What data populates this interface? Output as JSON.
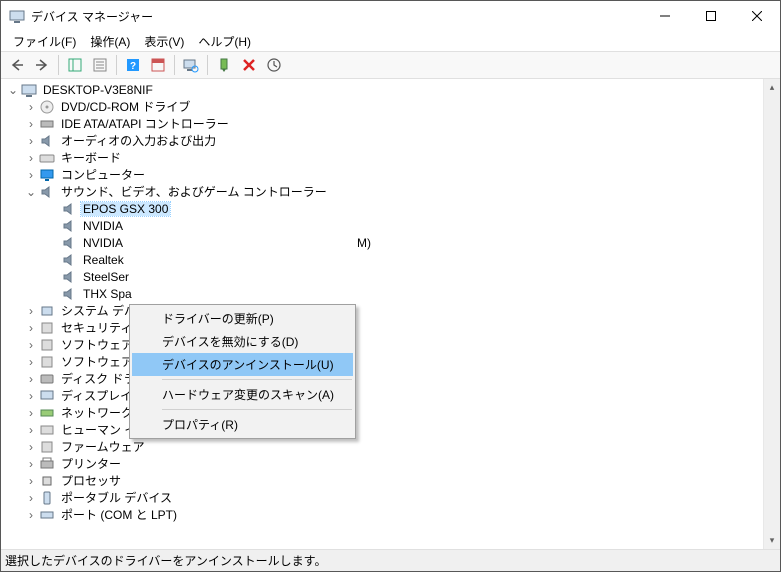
{
  "title": "デバイス マネージャー",
  "menubar": [
    "ファイル(F)",
    "操作(A)",
    "表示(V)",
    "ヘルプ(H)"
  ],
  "root": "DESKTOP-V3E8NIF",
  "categories": {
    "dvd": "DVD/CD-ROM ドライブ",
    "ide": "IDE ATA/ATAPI コントローラー",
    "audio": "オーディオの入力および出力",
    "keyboard": "キーボード",
    "computer": "コンピューター",
    "sound": "サウンド、ビデオ、およびゲーム コントローラー",
    "sysdev": "システム デバ",
    "security": "セキュリティ ラ",
    "softcomp": "ソフトウェア コンポーネント",
    "softdev": "ソフトウェア デバイス",
    "disk": "ディスク ドライブ",
    "display": "ディスプレイ アダプター",
    "network": "ネットワーク アダプター",
    "hid": "ヒューマン インターフェイス デバイス",
    "firmware": "ファームウェア",
    "printer": "プリンター",
    "cpu": "プロセッサ",
    "portable": "ポータブル デバイス",
    "ports": "ポート (COM と LPT)"
  },
  "sound_children": {
    "epos": "EPOS GSX 300",
    "nvidia1": "NVIDIA",
    "nvidia2": "NVIDIA",
    "nvidia2_suffix": "M)",
    "realtek": "Realtek",
    "steel": "SteelSer",
    "thx": "THX Spa"
  },
  "context": {
    "update": "ドライバーの更新(P)",
    "disable": "デバイスを無効にする(D)",
    "uninstall": "デバイスのアンインストール(U)",
    "scan": "ハードウェア変更のスキャン(A)",
    "props": "プロパティ(R)"
  },
  "status": "選択したデバイスのドライバーをアンインストールします。"
}
